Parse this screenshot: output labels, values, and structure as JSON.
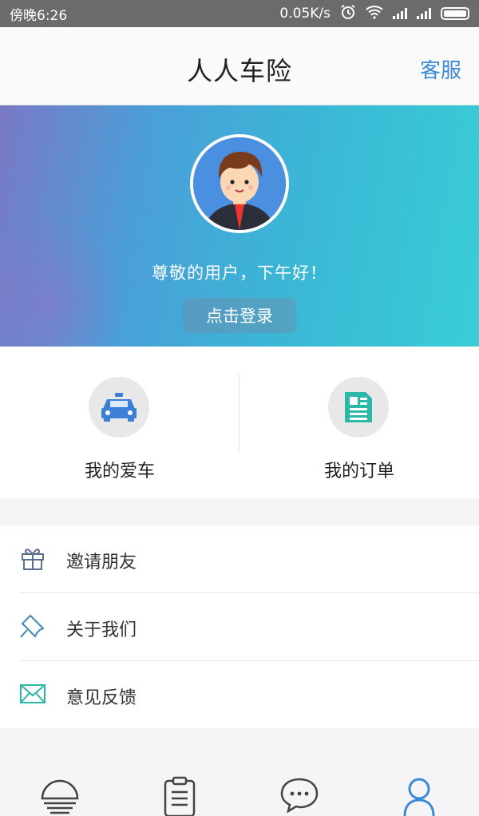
{
  "status_bar": {
    "left_text": "傍晚6:26",
    "net_speed": "0.05K/s",
    "icons": [
      "alarm-icon",
      "wifi-icon",
      "signal-icon",
      "signal-icon",
      "battery-icon"
    ]
  },
  "header": {
    "title": "人人车险",
    "service_label": "客服"
  },
  "profile": {
    "greeting": "尊敬的用户，下午好！",
    "login_label": "点击登录",
    "avatar_icon": "user-avatar"
  },
  "quick_entries": [
    {
      "label": "我的爱车",
      "icon": "car-icon",
      "color": "#3e7fd6"
    },
    {
      "label": "我的订单",
      "icon": "document-icon",
      "color": "#2bb8a6"
    }
  ],
  "menu": [
    {
      "label": "邀请朋友",
      "icon": "gift-icon",
      "color": "#5b6f8c"
    },
    {
      "label": "关于我们",
      "icon": "pin-icon",
      "color": "#3e87b8"
    },
    {
      "label": "意见反馈",
      "icon": "mail-icon",
      "color": "#2bb8a6"
    }
  ],
  "bottom_nav": [
    {
      "icon": "insurance-icon",
      "active": false
    },
    {
      "icon": "clipboard-icon",
      "active": false
    },
    {
      "icon": "chat-icon",
      "active": false
    },
    {
      "icon": "user-icon",
      "active": true
    }
  ],
  "colors": {
    "accent": "#3b8ad8",
    "status_bar": "#6b6b6b",
    "banner_start": "#7a78c6",
    "banner_end": "#39cdd6"
  }
}
